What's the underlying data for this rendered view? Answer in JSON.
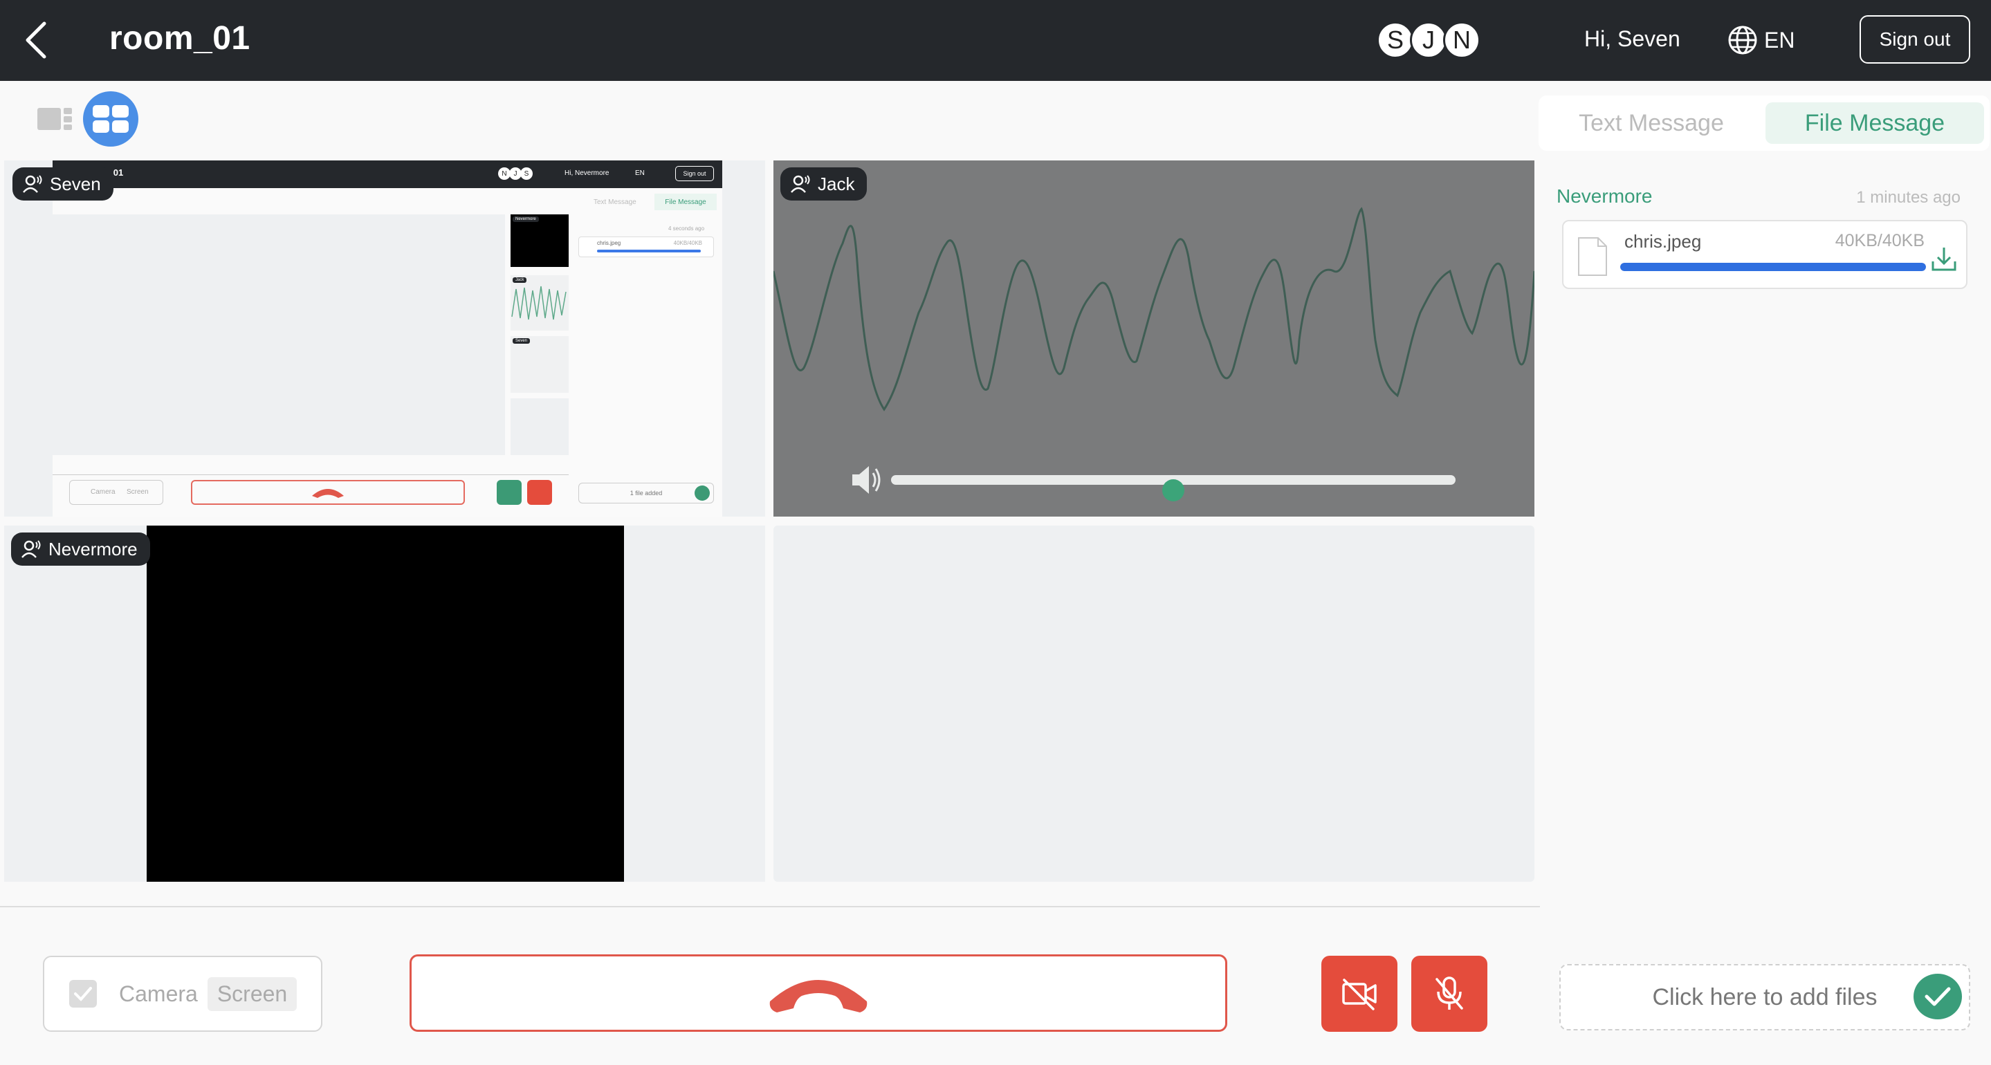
{
  "header": {
    "room_title": "room_01",
    "participants": [
      "S",
      "J",
      "N"
    ],
    "greeting": "Hi, Seven",
    "language": "EN",
    "sign_out": "Sign out"
  },
  "tiles": {
    "seven": {
      "name": "Seven",
      "shared_screen": {
        "title": "room_01",
        "participants": [
          "N",
          "J",
          "S"
        ],
        "greeting": "Hi, Nevermore",
        "language": "EN",
        "sign_out": "Sign out",
        "tab_text": "Text Message",
        "tab_file": "File Message",
        "time_ago": "4 seconds ago",
        "file_name": "chris.jpeg",
        "file_size": "40KB/40KB",
        "camera": "Camera",
        "screen": "Screen",
        "file_status": "1 file added",
        "side_names": [
          "Nevermore",
          "Jack",
          "Seven"
        ]
      }
    },
    "jack": {
      "name": "Jack",
      "volume": 0.5
    },
    "nevermore": {
      "name": "Nevermore"
    }
  },
  "controls": {
    "camera_label": "Camera",
    "screen_label": "Screen",
    "end_call_color": "#e0574b",
    "video_off_color": "#e44c3c",
    "mic_off_color": "#e44c3c"
  },
  "chat": {
    "tab_text": "Text Message",
    "tab_file": "File Message",
    "active_tab": "File Message",
    "messages": [
      {
        "sender": "Nevermore",
        "time": "1 minutes ago",
        "file_name": "chris.jpeg",
        "file_size": "40KB/40KB",
        "progress": 1.0
      }
    ],
    "add_files_placeholder": "Click here to add files"
  },
  "colors": {
    "header_bg": "#25282c",
    "accent_green": "#3a9d7a",
    "accent_blue": "#4b8fe6",
    "danger": "#e44c3c"
  }
}
